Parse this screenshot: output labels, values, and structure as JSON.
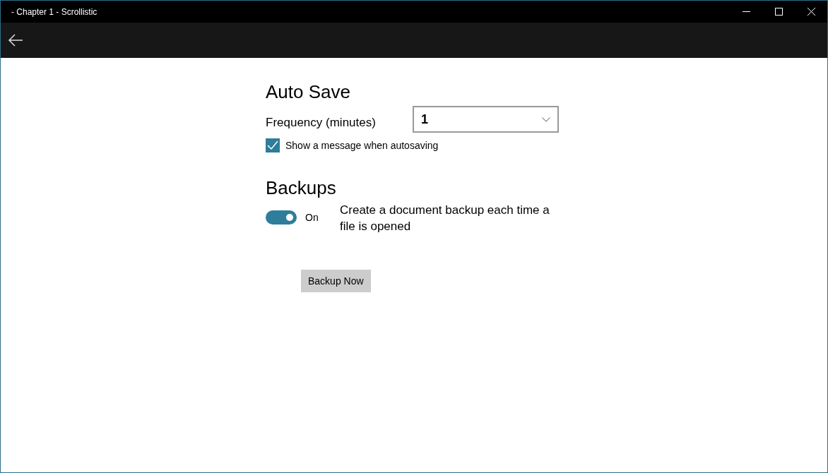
{
  "window": {
    "title": "- Chapter 1 - Scrollistic"
  },
  "auto_save": {
    "heading": "Auto Save",
    "frequency_label": "Frequency (minutes)",
    "frequency_value": "1",
    "show_message": {
      "label": "Show a message when autosaving",
      "checked": true
    }
  },
  "backups": {
    "heading": "Backups",
    "toggle": {
      "on": true,
      "state_label": "On"
    },
    "description": "Create a document backup each time a file is opened",
    "button": "Backup Now"
  }
}
